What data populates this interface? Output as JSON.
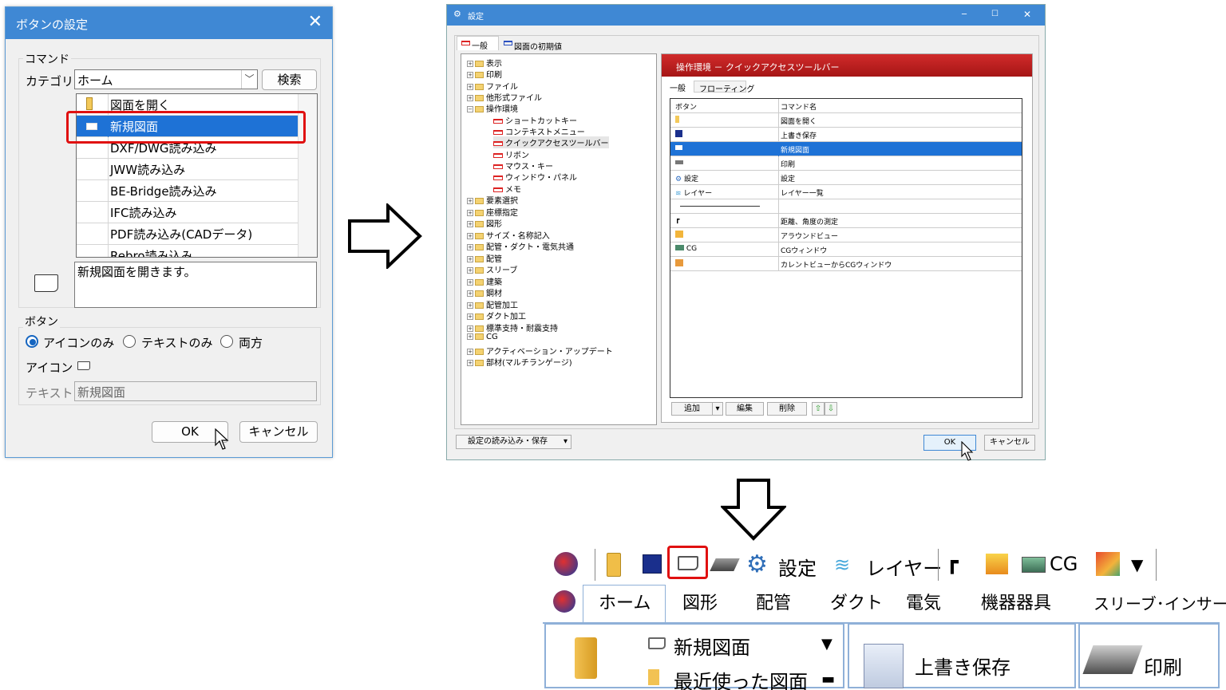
{
  "dialog1": {
    "title": "ボタンの設定",
    "command_group": "コマンド",
    "category_label": "カテゴリ",
    "category_value": "ホーム",
    "search_button": "検索",
    "commands": [
      "図面を開く",
      "新規図面",
      "DXF/DWG読み込み",
      "JWW読み込み",
      "BE-Bridge読み込み",
      "IFC読み込み",
      "PDF読み込み(CADデータ)",
      "Rebro読み込み"
    ],
    "selected_command": "新規図面",
    "description": "新規図面を開きます。",
    "button_group": "ボタン",
    "radio_icon_only": "アイコンのみ",
    "radio_text_only": "テキストのみ",
    "radio_both": "両方",
    "icon_label": "アイコン",
    "text_label": "テキスト",
    "text_value": "新規図面",
    "ok": "OK",
    "cancel": "キャンセル"
  },
  "dialog2": {
    "title": "設定",
    "tabs": [
      "一般",
      "図面の初期値"
    ],
    "tree": [
      "表示",
      "印刷",
      "ファイル",
      "他形式ファイル",
      "操作環境",
      "ショートカットキー",
      "コンテキストメニュー",
      "クイックアクセスツールバー",
      "リボン",
      "マウス・キー",
      "ウィンドウ・パネル",
      "メモ",
      "要素選択",
      "座標指定",
      "図形",
      "サイズ・名称記入",
      "配管・ダクト・電気共通",
      "配管",
      "スリーブ",
      "建築",
      "鋼材",
      "配管加工",
      "ダクト加工",
      "標準支持・耐震支持",
      "CG",
      "アクティベーション・アップデート",
      "部材(マルチランゲージ)"
    ],
    "panel_title": "操作環境 － クイックアクセスツールバー",
    "subtabs": [
      "一般",
      "フローティング"
    ],
    "col_button": "ボタン",
    "col_command": "コマンド名",
    "rows": [
      {
        "button": "",
        "command": "図面を開く"
      },
      {
        "button": "",
        "command": "上書き保存"
      },
      {
        "button": "",
        "command": "新規図面"
      },
      {
        "button": "",
        "command": "印刷"
      },
      {
        "button": "設定",
        "command": "設定"
      },
      {
        "button": "レイヤー",
        "command": "レイヤー一覧"
      },
      {
        "button": "",
        "command": ""
      },
      {
        "button": "",
        "command": "距離、角度の測定"
      },
      {
        "button": "",
        "command": "アラウンドビュー"
      },
      {
        "button": "CG",
        "command": "CGウィンドウ"
      },
      {
        "button": "",
        "command": "カレントビューからCGウィンドウ"
      }
    ],
    "add": "追加",
    "edit": "編集",
    "delete": "削除",
    "load_save": "設定の読み込み・保存",
    "ok": "OK",
    "cancel": "キャンセル"
  },
  "ribbon": {
    "qat_settings": "設定",
    "qat_layer": "レイヤー",
    "qat_cg": "CG",
    "tabs": [
      "ホーム",
      "図形",
      "配管",
      "ダクト",
      "電気",
      "機器器具",
      "スリーブ･インサート"
    ],
    "new_drawing": "新規図面",
    "recent": "最近使った図面",
    "save": "上書き保存",
    "print": "印刷"
  }
}
